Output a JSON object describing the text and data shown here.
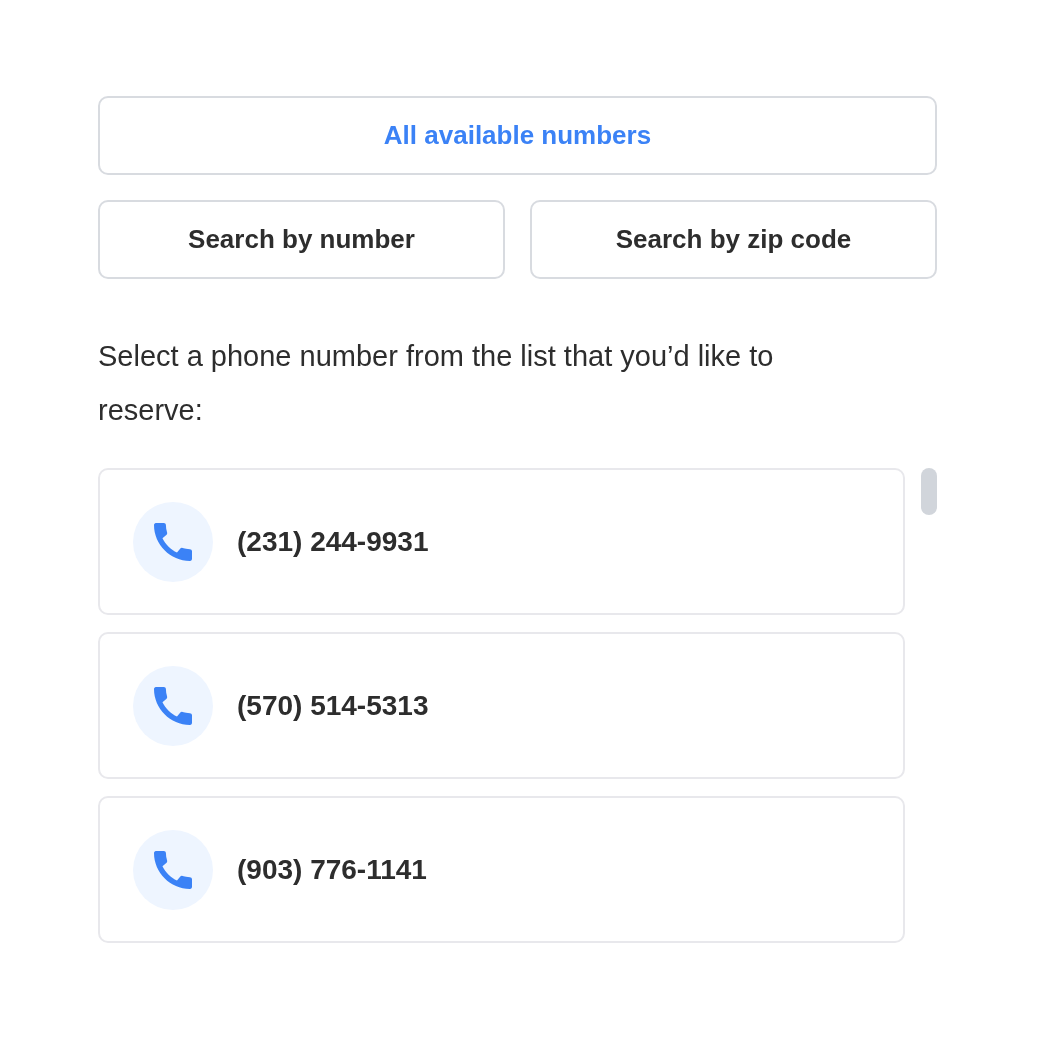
{
  "tabs": [
    {
      "label": "All available numbers",
      "selected": true
    },
    {
      "label": "Search by number",
      "selected": false
    },
    {
      "label": "Search by zip code",
      "selected": false
    }
  ],
  "instructions": "Select a phone number from the list that you’d like to reserve:",
  "numbers": [
    {
      "number": "(231) 244-9931"
    },
    {
      "number": "(570) 514-5313"
    },
    {
      "number": "(903) 776-1141"
    }
  ]
}
